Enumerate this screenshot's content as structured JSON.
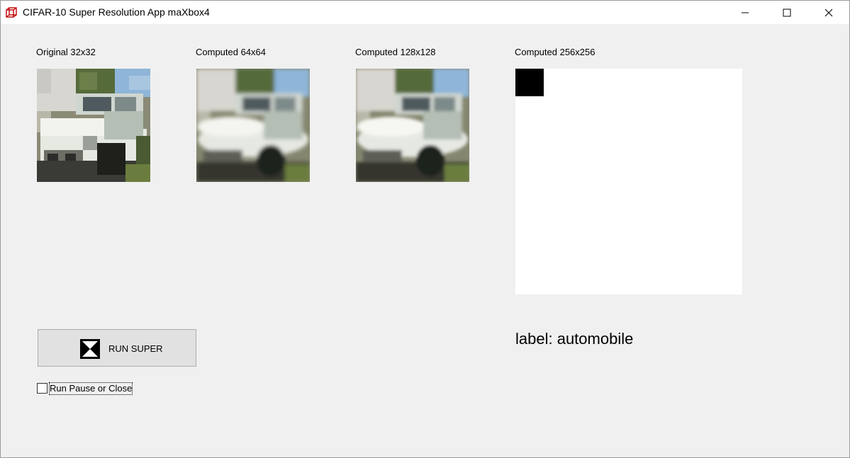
{
  "window": {
    "title": "CIFAR-10 Super Resolution App maXbox4",
    "icons": {
      "app": "app-cube-icon",
      "minimize": "minimize-icon",
      "maximize": "maximize-icon",
      "close": "close-icon"
    }
  },
  "images": [
    {
      "caption": "Original 32x32"
    },
    {
      "caption": "Computed 64x64"
    },
    {
      "caption": "Computed 128x128"
    },
    {
      "caption": "Computed 256x256"
    }
  ],
  "result": {
    "label": "label: automobile"
  },
  "controls": {
    "run_button": {
      "label": "RUN SUPER",
      "icon": "x-cross-icon"
    },
    "pause_checkbox": {
      "label": "Run Pause or Close",
      "checked": false
    }
  },
  "colors": {
    "window_bg": "#f0f0f0",
    "titlebar_bg": "#ffffff",
    "button_bg": "#e1e1e1",
    "button_border": "#adadad"
  }
}
